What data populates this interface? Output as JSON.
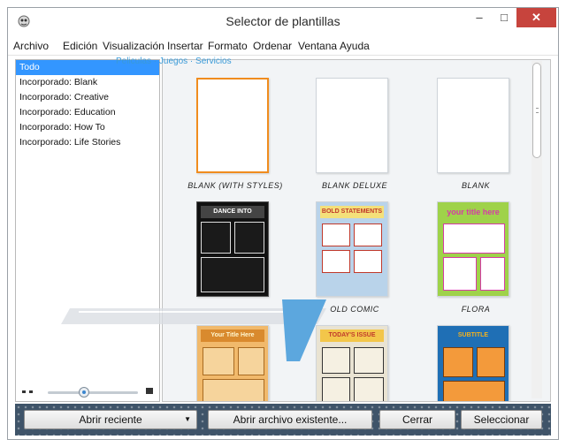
{
  "window": {
    "title": "Selector de plantillas",
    "min": "–",
    "max": "□",
    "close": "✕"
  },
  "menu": [
    "Archivo",
    "Edición",
    "Visualización",
    "Insertar",
    "Formato",
    "Ordenar",
    "Ventana",
    "Ayuda"
  ],
  "sidebar": {
    "items": [
      "Todo",
      "Incorporado: Blank",
      "Incorporado: Creative",
      "Incorporado: Education",
      "Incorporado: How To",
      "Incorporado: Life Stories"
    ],
    "selected_index": 0
  },
  "zoom": {
    "level": 0.4
  },
  "templates": [
    {
      "caption": "BLANK (WITH STYLES)",
      "kind": "blank",
      "selected": true
    },
    {
      "caption": "BLANK DELUXE",
      "kind": "blank",
      "selected": false
    },
    {
      "caption": "BLANK",
      "kind": "blank",
      "selected": false
    },
    {
      "caption": "",
      "kind": "dark",
      "heading": "DANCE INTO BATTLE",
      "selected": false
    },
    {
      "caption": "OLD COMIC",
      "kind": "bold",
      "heading": "BOLD STATEMENTS",
      "selected": false
    },
    {
      "caption": "FLORA",
      "kind": "flora",
      "heading": "your title here",
      "selected": false
    },
    {
      "caption": "",
      "kind": "parchment",
      "heading": "Your Title Here",
      "selected": false
    },
    {
      "caption": "",
      "kind": "retro",
      "heading": "TODAY'S ISSUE",
      "selected": false
    },
    {
      "caption": "",
      "kind": "blue",
      "heading": "SUBTITLE",
      "selected": false
    }
  ],
  "watermark": {
    "text": "Peliculas · Juegos · Servicios"
  },
  "buttons": {
    "recent": "Abrir reciente",
    "open_existing": "Abrir archivo existente...",
    "close": "Cerrar",
    "select": "Seleccionar"
  },
  "colors": {
    "selection": "#3396ff",
    "selected_border": "#f08c1e",
    "bottombar": "#3f5469",
    "close_button": "#c7443d"
  }
}
